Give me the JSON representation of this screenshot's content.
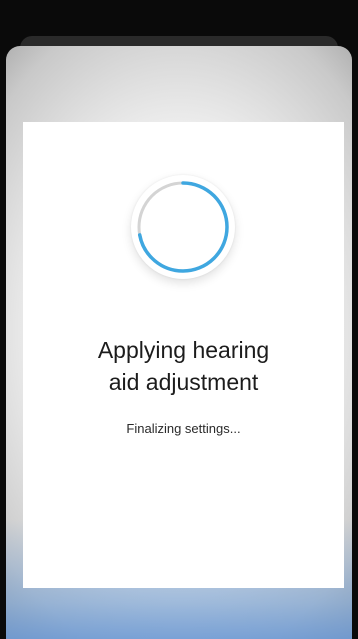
{
  "dialog": {
    "title_line1": "Applying hearing",
    "title_line2": "aid adjustment",
    "subtitle": "Finalizing settings..."
  },
  "spinner": {
    "icon": "progress-spinner-icon",
    "progress_fraction": 0.72,
    "track_color": "#d4d4d4",
    "progress_color": "#3fa7e0"
  },
  "colors": {
    "card_background": "#ffffff",
    "title_text": "#1c1c1c",
    "subtitle_text": "#2a2a2a"
  }
}
